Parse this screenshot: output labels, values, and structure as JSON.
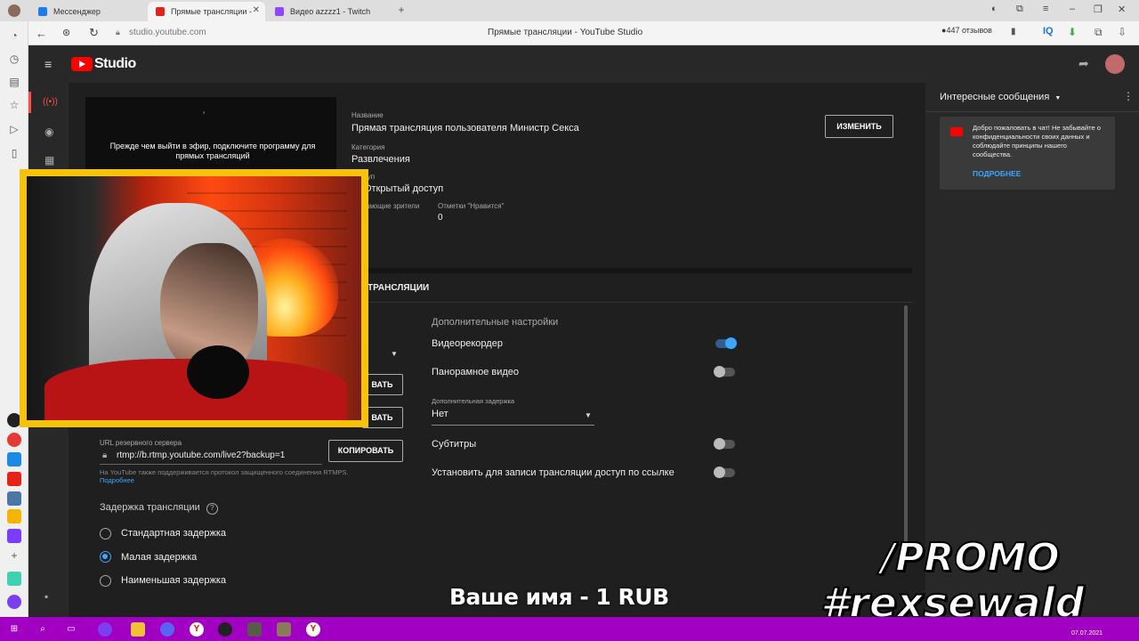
{
  "browser": {
    "tabs": [
      {
        "title": "Мессенджер",
        "active": false
      },
      {
        "title": "Прямые трансляции - ",
        "active": true
      },
      {
        "title": "Видео azzzz1 - Twitch",
        "active": false
      }
    ],
    "url": "studio.youtube.com",
    "page_title": "Прямые трансляции - YouTube Studio",
    "reviews": "447 отзывов"
  },
  "studio": {
    "logo_text": "Studio",
    "preview_message": "Прежде чем выйти в эфир, подключите программу для прямых трансляций",
    "title_label": "Название",
    "title_value": "Прямая трансляция пользователя Министр Секса",
    "category_label": "Категория",
    "category_value": "Развлечения",
    "privacy_label_partial": "туп",
    "privacy_value": "Открытый доступ",
    "viewers_label_partial": "дающие зрители",
    "likes_label": "Отметки \"Нравится\"",
    "likes_value": "0",
    "edit_button": "ИЗМЕНИТЬ",
    "section_title_partial": "ТРАНСЛЯЦИИ",
    "copy_partial_1": "ВАТЬ",
    "copy_partial_2": "ВАТЬ",
    "backup_url_label": "URL резервного сервера",
    "backup_url_value": "rtmp://b.rtmp.youtube.com/live2?backup=1",
    "copy_button": "КОПИРОВАТЬ",
    "rtmps_note": "На YouTube также поддерживается протокол защищенного соединения RTMPS.",
    "more_link": "Подробнее",
    "latency_title": "Задержка трансляции",
    "latency_options": [
      {
        "label": "Стандартная задержка",
        "selected": false
      },
      {
        "label": "Малая задержка",
        "selected": true
      },
      {
        "label": "Наименьшая задержка",
        "selected": false
      }
    ],
    "extra_title": "Дополнительные настройки",
    "settings": [
      {
        "label": "Видеорекордер",
        "on": true
      },
      {
        "label": "Панорамное видео",
        "on": false
      }
    ],
    "delay_label": "Дополнительная задержка",
    "delay_value": "Нет",
    "settings2": [
      {
        "label": "Субтитры",
        "on": false
      },
      {
        "label": "Установить для записи трансляции доступ по ссылке",
        "on": false
      }
    ]
  },
  "chat": {
    "header": "Интересные сообщения",
    "welcome": "Добро пожаловать в чат! Не забывайте о конфиденциальности своих данных и соблюдайте принципы нашего сообщества.",
    "more": "ПОДРОБНЕЕ"
  },
  "overlay": {
    "promo_line1": "/PROMO",
    "promo_line2": "#rexsewald",
    "donation": "Ваше имя - 1 RUB"
  },
  "taskbar": {
    "date": "07.07.2021"
  }
}
